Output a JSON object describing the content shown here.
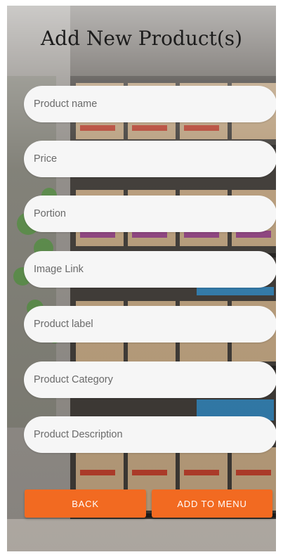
{
  "header": {
    "title": "Add New Product(s)"
  },
  "form": {
    "fields": [
      {
        "placeholder": "Product name",
        "value": ""
      },
      {
        "placeholder": "Price",
        "value": ""
      },
      {
        "placeholder": "Portion",
        "value": ""
      },
      {
        "placeholder": "Image Link",
        "value": ""
      },
      {
        "placeholder": "Product label",
        "value": ""
      },
      {
        "placeholder": "Product Category",
        "value": ""
      },
      {
        "placeholder": "Product Description",
        "value": ""
      }
    ]
  },
  "actions": {
    "back_label": "BACK",
    "add_label": "ADD TO MENU"
  },
  "colors": {
    "accent": "#F26A21",
    "field_bg": "#F6F6F6",
    "title": "#1C1C1C"
  },
  "background": {
    "image": "coffee-shop-shelves-photo"
  }
}
